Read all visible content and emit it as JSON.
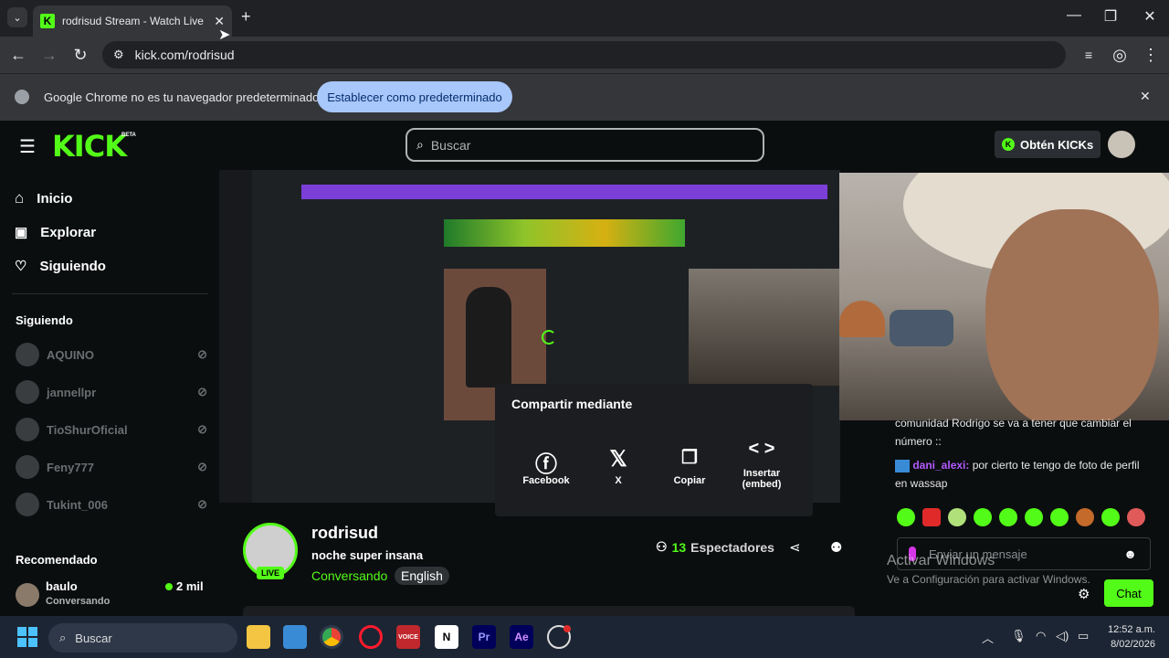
{
  "browser": {
    "tab_title": "rodrisud Stream - Watch Live o",
    "url": "kick.com/rodrisud",
    "infobar_text": "Google Chrome no es tu navegador predeterminado",
    "infobar_button": "Establecer como predeterminado"
  },
  "kick": {
    "logo": "KICK",
    "beta": "BETA",
    "search_placeholder": "Buscar",
    "get_kicks": "Obtén KICKs"
  },
  "sidebar": {
    "nav": [
      {
        "label": "Inicio",
        "icon": "home-icon"
      },
      {
        "label": "Explorar",
        "icon": "browse-icon"
      },
      {
        "label": "Siguiendo",
        "icon": "heart-icon"
      }
    ],
    "following_title": "Siguiendo",
    "following": [
      "AQUINO",
      "jannellpr",
      "TioShurOficial",
      "Feny777",
      "Tukint_006"
    ],
    "recommended_title": "Recomendado",
    "recommended": {
      "name": "baulo",
      "category": "Conversando",
      "viewers": "2 mil"
    }
  },
  "share": {
    "title": "Compartir mediante",
    "options": [
      "Facebook",
      "X",
      "Copiar",
      "Insertar (embed)"
    ]
  },
  "stream": {
    "username": "rodrisud",
    "stream_title": "noche super insana",
    "category": "Conversando",
    "language": "English",
    "live": "LIVE",
    "viewer_count": "13",
    "viewer_label": "Espectadores"
  },
  "chat": {
    "msg1_text": "comunidad Rodrigo se va a tener que cambiar el número ::",
    "msg2_user": "dani_alexi:",
    "msg2_text": " por cierto te tengo de foto de perfil en wassap",
    "input_placeholder": "Enviar un mensaje",
    "chat_button": "Chat"
  },
  "windows": {
    "watermark_title": "Activar Windows",
    "watermark_sub": "Ve a Configuración para activar Windows.",
    "taskbar_search": "Buscar",
    "time": "12:52 a.m.",
    "date": "8/02/2026"
  },
  "colors": {
    "kick_green": "#53fc18",
    "background": "#0b0e0f"
  }
}
